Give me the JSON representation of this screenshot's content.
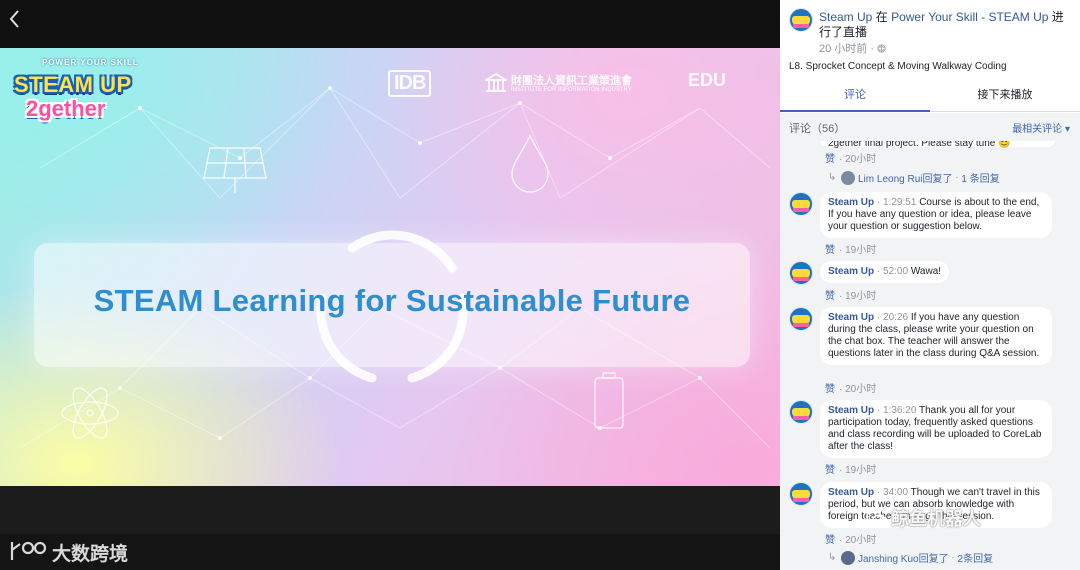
{
  "viewer": {
    "logo_small": "POWER YOUR SKILL",
    "logo_main": "STEAM UP",
    "logo_sub": "2gether",
    "partner_idb": "IDB",
    "partner_iii_zh": "財團法人資訊工業策進會",
    "partner_iii_en": "INSTITUTE FOR INFORMATION INDUSTRY",
    "partner_edu": "EDU",
    "banner_text": "STEAM Learning for Sustainable Future",
    "watermark_text": "大数跨境"
  },
  "post": {
    "author": "Steam Up",
    "connector": "在",
    "group": "Power Your Skill - STEAM Up",
    "action": "进行了直播",
    "time": "20 小时前",
    "separator": "·",
    "description": "L8. Sprocket Concept & Moving Walkway Coding"
  },
  "tabs": {
    "comments": "评论",
    "up_next": "接下来播放"
  },
  "comment_bar": {
    "count": "评论（56）",
    "sort": "最相关评论 ▾"
  },
  "comments": [
    {
      "partial": "2gether final project. Please stay tune 😊",
      "like": "赞",
      "sep": "·",
      "time": "20小时",
      "reply_name": "Lim Leong Rui回复了",
      "reply_sep": "·",
      "reply_count": "1 条回复"
    },
    {
      "author": "Steam Up",
      "sep1": "·",
      "timestamp": "1:29:51",
      "text": "Course is about to the end, If you have any question or idea, please leave your question or suggestion below.",
      "like": "赞",
      "sep": "·",
      "time": "19小时"
    },
    {
      "author": "Steam Up",
      "sep1": "·",
      "timestamp": "52:00",
      "text": "Wawa!",
      "like": "赞",
      "sep": "·",
      "time": "19小时"
    },
    {
      "author": "Steam Up",
      "sep1": "·",
      "timestamp": "20:26",
      "text": "If you have any question during the class, please write your question on the chat box. The teacher will answer the questions later in the class during Q&A session.",
      "like": "赞",
      "sep": "·",
      "time": "20小时"
    },
    {
      "author": "Steam Up",
      "sep1": "·",
      "timestamp": "1:36:20",
      "text": "Thank you all for your participation today, frequently asked questions and class recording will be uploaded to CoreLab after the class!",
      "like": "赞",
      "sep": "·",
      "time": "19小时"
    },
    {
      "author": "Steam Up",
      "sep1": "·",
      "timestamp": "34:00",
      "text": "Though we can't travel in this period, but we can absorb knowledge with foreign teachers through this session.",
      "like": "赞",
      "sep": "·",
      "time": "20小时",
      "reply_name": "Janshing Kuo回复了",
      "reply_sep": "·",
      "reply_count": "2条回复"
    }
  ],
  "sidebar_watermark": "鲸鱼机器人"
}
